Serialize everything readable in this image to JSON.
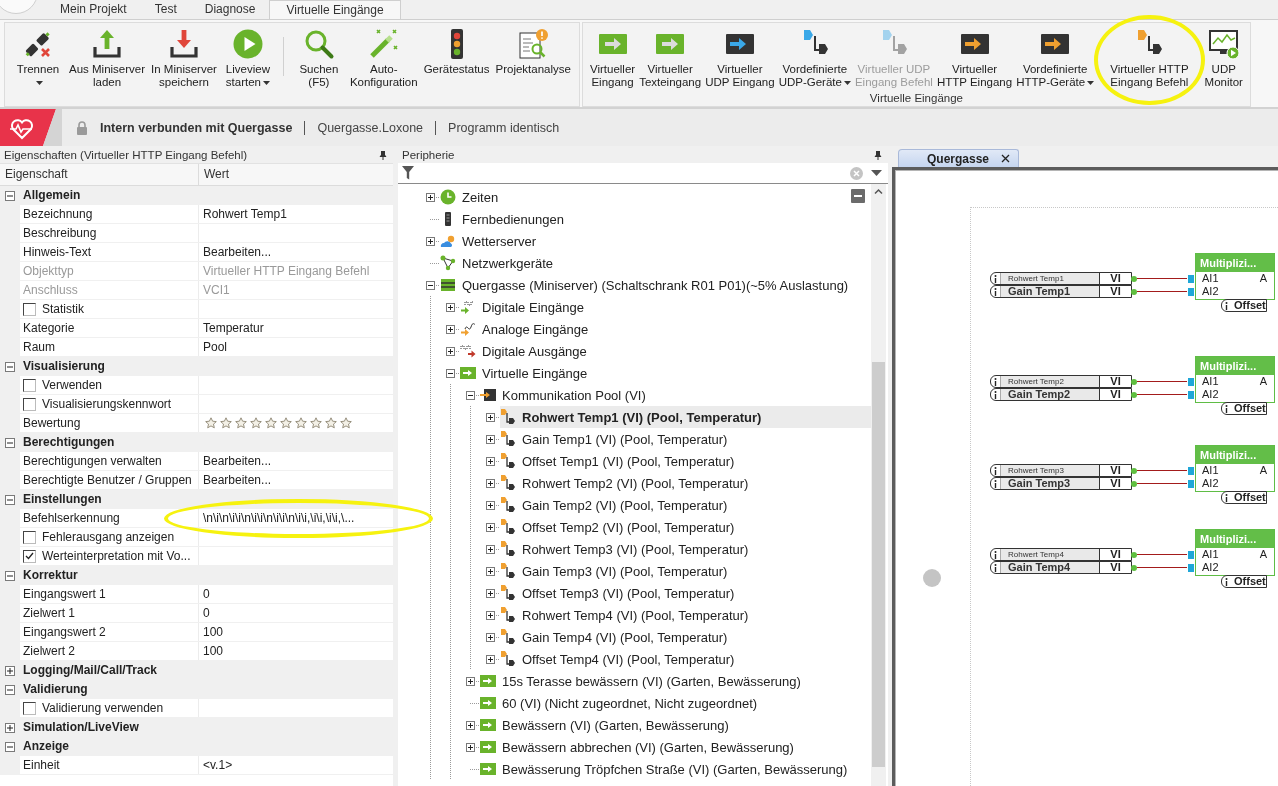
{
  "app_tabs": [
    {
      "label": "Mein Projekt",
      "selected": false
    },
    {
      "label": "Test",
      "selected": false
    },
    {
      "label": "Diagnose",
      "selected": false
    },
    {
      "label": "Virtuelle Eingänge",
      "selected": true
    }
  ],
  "ribbon": {
    "groups": [
      {
        "sets": [
          {
            "buttons": [
              {
                "kind": "disconnect",
                "label": "Trennen",
                "dropdown": true,
                "disabled": false,
                "highlighted": false
              },
              {
                "kind": "upload",
                "label": "Aus Miniserver\nladen",
                "disabled": false,
                "highlighted": false
              },
              {
                "kind": "download",
                "label": "In Miniserver\nspeichern",
                "disabled": false,
                "highlighted": false
              },
              {
                "kind": "play",
                "label": "Liveview\nstarten",
                "dropdown": true,
                "disabled": false,
                "highlighted": false
              }
            ]
          },
          {
            "buttons": [
              {
                "kind": "search",
                "label": "Suchen\n(F5)",
                "disabled": false,
                "highlighted": false
              },
              {
                "kind": "wand",
                "label": "Auto-\nKonfiguration",
                "disabled": false,
                "highlighted": false
              },
              {
                "kind": "traffic-light",
                "label": "Gerätestatus",
                "disabled": false,
                "highlighted": false
              },
              {
                "kind": "report",
                "label": "Projektanalyse",
                "disabled": false,
                "highlighted": false
              }
            ]
          }
        ]
      },
      {
        "label": "Virtuelle Eingänge",
        "sets": [
          {
            "buttons": [
              {
                "kind": "vi-green",
                "label": "Virtueller\nEingang",
                "disabled": false,
                "highlighted": false
              },
              {
                "kind": "vi-green",
                "label": "Virtueller\nTexteingang",
                "disabled": false,
                "highlighted": false
              },
              {
                "kind": "vi-udp",
                "label": "Virtueller\nUDP Eingang",
                "disabled": false,
                "highlighted": false
              },
              {
                "kind": "udp-command",
                "label": "Vordefinierte\nUDP-Geräte",
                "dropdown": true,
                "disabled": false,
                "highlighted": false
              },
              {
                "kind": "udp-command",
                "label": "Virtueller UDP\nEingang Befehl",
                "disabled": true,
                "highlighted": false
              },
              {
                "kind": "vi-http",
                "label": "Virtueller\nHTTP Eingang",
                "disabled": false,
                "highlighted": false
              },
              {
                "kind": "vi-http",
                "label": "Vordefinierte\nHTTP-Geräte",
                "dropdown": true,
                "disabled": false,
                "highlighted": false
              },
              {
                "kind": "http-command",
                "label": "Virtueller HTTP\nEingang Befehl",
                "disabled": false,
                "highlighted": true
              },
              {
                "kind": "monitor",
                "label": "UDP\nMonitor",
                "disabled": false,
                "highlighted": false
              }
            ]
          }
        ]
      }
    ]
  },
  "status_bar": {
    "connection": "Intern verbunden mit Quergasse",
    "project": "Quergasse.Loxone",
    "program": "Programm identisch"
  },
  "properties": {
    "title": "Eigenschaften (Virtueller HTTP Eingang Befehl)",
    "columns": [
      "Eigenschaft",
      "Wert"
    ],
    "sections": [
      {
        "title": "Allgemein",
        "expanded": true,
        "rows": [
          {
            "kind": "text",
            "name": "Bezeichnung",
            "value": "Rohwert Temp1",
            "disabled": false,
            "highlighted": false
          },
          {
            "kind": "text",
            "name": "Beschreibung",
            "disabled": false,
            "highlighted": false
          },
          {
            "kind": "text",
            "name": "Hinweis-Text",
            "value": "Bearbeiten...",
            "disabled": false,
            "highlighted": false
          },
          {
            "kind": "text",
            "name": "Objekttyp",
            "value": "Virtueller HTTP Eingang Befehl",
            "disabled": true,
            "highlighted": false
          },
          {
            "kind": "text",
            "name": "Anschluss",
            "value": "VCI1",
            "disabled": true,
            "highlighted": false
          },
          {
            "kind": "checkbox",
            "name": "Statistik",
            "checked": false,
            "disabled": false,
            "highlighted": false
          },
          {
            "kind": "text",
            "name": "Kategorie",
            "value": "Temperatur",
            "disabled": false,
            "highlighted": false
          },
          {
            "kind": "text",
            "name": "Raum",
            "value": "Pool",
            "disabled": false,
            "highlighted": false
          }
        ]
      },
      {
        "title": "Visualisierung",
        "expanded": true,
        "rows": [
          {
            "kind": "checkbox",
            "name": "Verwenden",
            "checked": false,
            "disabled": false,
            "highlighted": false
          },
          {
            "kind": "checkbox",
            "name": "Visualisierungskennwort",
            "checked": false,
            "disabled": false,
            "highlighted": false
          },
          {
            "kind": "rating",
            "name": "Bewertung",
            "stars": 0,
            "disabled": false,
            "highlighted": false
          }
        ]
      },
      {
        "title": "Berechtigungen",
        "expanded": true,
        "rows": [
          {
            "kind": "text",
            "name": "Berechtigungen verwalten",
            "value": "Bearbeiten...",
            "disabled": false,
            "highlighted": false
          },
          {
            "kind": "text",
            "name": "Berechtigte Benutzer / Gruppen",
            "value": "Bearbeiten...",
            "disabled": false,
            "highlighted": false
          }
        ]
      },
      {
        "title": "Einstellungen",
        "expanded": true,
        "rows": [
          {
            "kind": "text",
            "name": "Befehlserkennung",
            "value": "\\n\\i\\n\\i\\i\\n\\i\\i\\n\\i\\i\\n\\i\\i,\\i\\i,\\i\\i,\\...",
            "disabled": false,
            "highlighted": true
          },
          {
            "kind": "checkbox",
            "name": "Fehlerausgang anzeigen",
            "checked": false,
            "disabled": false,
            "highlighted": false
          },
          {
            "kind": "checkbox",
            "name": "Werteinterpretation mit Vo...",
            "checked": true,
            "disabled": false,
            "highlighted": false
          }
        ]
      },
      {
        "title": "Korrektur",
        "expanded": true,
        "rows": [
          {
            "kind": "text",
            "name": "Eingangswert 1",
            "value": "0",
            "disabled": false,
            "highlighted": false
          },
          {
            "kind": "text",
            "name": "Zielwert 1",
            "value": "0",
            "disabled": false,
            "highlighted": false
          },
          {
            "kind": "text",
            "name": "Eingangswert 2",
            "value": "100",
            "disabled": false,
            "highlighted": false
          },
          {
            "kind": "text",
            "name": "Zielwert 2",
            "value": "100",
            "disabled": false,
            "highlighted": false
          }
        ]
      },
      {
        "title": "Logging/Mail/Call/Track",
        "expanded": false
      },
      {
        "title": "Validierung",
        "expanded": true,
        "rows": [
          {
            "kind": "checkbox",
            "name": "Validierung verwenden",
            "checked": false,
            "disabled": false,
            "highlighted": false
          }
        ]
      },
      {
        "title": "Simulation/LiveView",
        "expanded": false
      },
      {
        "title": "Anzeige",
        "expanded": true,
        "rows": [
          {
            "kind": "text",
            "name": "Einheit",
            "value": "<v.1>",
            "disabled": false,
            "highlighted": false
          }
        ]
      }
    ]
  },
  "periphery": {
    "title": "Peripherie",
    "tree": [
      {
        "label": "Zeiten",
        "kind": "clock",
        "selected": false,
        "expanded": false
      },
      {
        "label": "Fernbedienungen",
        "kind": "remote",
        "selected": false
      },
      {
        "label": "Wetterserver",
        "kind": "weather",
        "selected": false,
        "expanded": false
      },
      {
        "label": "Netzwerkgeräte",
        "kind": "network",
        "selected": false
      },
      {
        "label": "Quergasse (Miniserver) (Schaltschrank R01 P01)(~5% Auslastung)",
        "kind": "miniserver",
        "selected": false,
        "expanded": true,
        "children": [
          {
            "label": "Digitale Eingänge",
            "kind": "digital-in",
            "selected": false,
            "expanded": false
          },
          {
            "label": "Analoge Eingänge",
            "kind": "analog-in",
            "selected": false,
            "expanded": false
          },
          {
            "label": "Digitale Ausgänge",
            "kind": "digital-out",
            "selected": false,
            "expanded": false
          },
          {
            "label": "Virtuelle Eingänge",
            "kind": "virtual-in",
            "selected": false,
            "expanded": true,
            "children": [
              {
                "label": "Kommunikation Pool (VI)",
                "kind": "vi-group",
                "selected": false,
                "expanded": true,
                "children": [
                  {
                    "label": "Rohwert Temp1 (VI) (Pool, Temperatur)",
                    "kind": "vi-command",
                    "selected": true,
                    "expanded": false
                  },
                  {
                    "label": "Gain Temp1 (VI) (Pool, Temperatur)",
                    "kind": "vi-command",
                    "selected": false,
                    "expanded": false
                  },
                  {
                    "label": "Offset Temp1 (VI) (Pool, Temperatur)",
                    "kind": "vi-command",
                    "selected": false,
                    "expanded": false
                  },
                  {
                    "label": "Rohwert Temp2 (VI) (Pool, Temperatur)",
                    "kind": "vi-command",
                    "selected": false,
                    "expanded": false
                  },
                  {
                    "label": "Gain Temp2 (VI) (Pool, Temperatur)",
                    "kind": "vi-command",
                    "selected": false,
                    "expanded": false
                  },
                  {
                    "label": "Offset Temp2 (VI) (Pool, Temperatur)",
                    "kind": "vi-command",
                    "selected": false,
                    "expanded": false
                  },
                  {
                    "label": "Rohwert Temp3 (VI) (Pool, Temperatur)",
                    "kind": "vi-command",
                    "selected": false,
                    "expanded": false
                  },
                  {
                    "label": "Gain Temp3 (VI) (Pool, Temperatur)",
                    "kind": "vi-command",
                    "selected": false,
                    "expanded": false
                  },
                  {
                    "label": "Offset Temp3 (VI) (Pool, Temperatur)",
                    "kind": "vi-command",
                    "selected": false,
                    "expanded": false
                  },
                  {
                    "label": "Rohwert Temp4 (VI) (Pool, Temperatur)",
                    "kind": "vi-command",
                    "selected": false,
                    "expanded": false
                  },
                  {
                    "label": "Gain Temp4 (VI) (Pool, Temperatur)",
                    "kind": "vi-command",
                    "selected": false,
                    "expanded": false
                  },
                  {
                    "label": "Offset Temp4 (VI) (Pool, Temperatur)",
                    "kind": "vi-command",
                    "selected": false,
                    "expanded": false
                  }
                ]
              },
              {
                "label": "15s Terasse bewässern (VI) (Garten, Bewässerung)",
                "kind": "virtual-in",
                "selected": false,
                "expanded": false
              },
              {
                "label": "60 (VI) (Nicht zugeordnet, Nicht zugeordnet)",
                "kind": "virtual-in",
                "selected": false
              },
              {
                "label": "Bewässern (VI) (Garten, Bewässerung)",
                "kind": "virtual-in",
                "selected": false,
                "expanded": false
              },
              {
                "label": "Bewässern abbrechen (VI) (Garten, Bewässerung)",
                "kind": "virtual-in",
                "selected": false,
                "expanded": false
              },
              {
                "label": "Bewässerung Tröpfchen Straße (VI) (Garten, Bewässerung)",
                "kind": "virtual-in",
                "selected": false
              }
            ]
          }
        ]
      }
    ]
  },
  "document_tabs": [
    {
      "label": "Quergasse",
      "selected": true
    }
  ],
  "canvas": {
    "groups": [
      {
        "inputs": [
          {
            "label": "Rohwert Temp1",
            "type": "VI"
          },
          {
            "label": "Gain Temp1",
            "type": "VI"
          }
        ],
        "block": {
          "title": "Multiplizi...",
          "inputs": [
            "AI1",
            "AI2"
          ],
          "output": "A",
          "parameter": "Offset"
        }
      },
      {
        "inputs": [
          {
            "label": "Rohwert Temp2",
            "type": "VI"
          },
          {
            "label": "Gain Temp2",
            "type": "VI"
          }
        ],
        "block": {
          "title": "Multiplizi...",
          "inputs": [
            "AI1",
            "AI2"
          ],
          "output": "A",
          "parameter": "Offset"
        }
      },
      {
        "inputs": [
          {
            "label": "Rohwert Temp3",
            "type": "VI"
          },
          {
            "label": "Gain Temp3",
            "type": "VI"
          }
        ],
        "block": {
          "title": "Multiplizi...",
          "inputs": [
            "AI1",
            "AI2"
          ],
          "output": "A",
          "parameter": "Offset"
        }
      },
      {
        "inputs": [
          {
            "label": "Rohwert Temp4",
            "type": "VI"
          },
          {
            "label": "Gain Temp4",
            "type": "VI"
          }
        ],
        "block": {
          "title": "Multiplizi...",
          "inputs": [
            "AI1",
            "AI2"
          ],
          "output": "A",
          "parameter": "Offset"
        }
      }
    ]
  }
}
